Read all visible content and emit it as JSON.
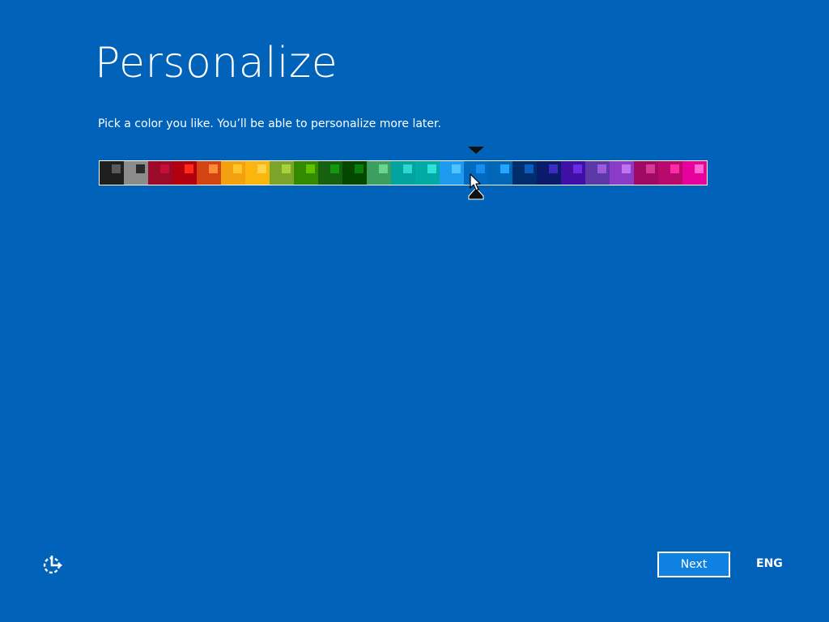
{
  "page": {
    "title": "Personalize",
    "subtitle": "Pick a color you like. You’ll be able to personalize more later."
  },
  "color_picker": {
    "selected_index": 15,
    "swatches": [
      {
        "bg": "#1f1f1f",
        "accent": "#5a5a5a"
      },
      {
        "bg": "#8c8c8c",
        "accent": "#2a2a2a"
      },
      {
        "bg": "#9c0a2a",
        "accent": "#c50f39"
      },
      {
        "bg": "#b3000e",
        "accent": "#ff2a1a"
      },
      {
        "bg": "#d24411",
        "accent": "#ff8a3a"
      },
      {
        "bg": "#f2a20e",
        "accent": "#ffc52e"
      },
      {
        "bg": "#fab60e",
        "accent": "#ffd34a"
      },
      {
        "bg": "#7aa52a",
        "accent": "#a8d23c"
      },
      {
        "bg": "#338a00",
        "accent": "#5fc400"
      },
      {
        "bg": "#15610f",
        "accent": "#0f9a0f"
      },
      {
        "bg": "#044800",
        "accent": "#0b7f0b"
      },
      {
        "bg": "#3c9e5f",
        "accent": "#6bd48e"
      },
      {
        "bg": "#00a39e",
        "accent": "#2fd7d2"
      },
      {
        "bg": "#00aaa5",
        "accent": "#30e0db"
      },
      {
        "bg": "#1e9bf0",
        "accent": "#52c3ff"
      },
      {
        "bg": "#006ac1",
        "accent": "#168ef0"
      },
      {
        "bg": "#0067b8",
        "accent": "#22a8ff"
      },
      {
        "bg": "#002d6b",
        "accent": "#0a5ec0"
      },
      {
        "bg": "#0a1b6b",
        "accent": "#3a2dc0"
      },
      {
        "bg": "#3f0fa8",
        "accent": "#6b2be0"
      },
      {
        "bg": "#5b3aa8",
        "accent": "#9b5ce0"
      },
      {
        "bg": "#8a3cc8",
        "accent": "#c074f0"
      },
      {
        "bg": "#9e0a64",
        "accent": "#d63a92"
      },
      {
        "bg": "#b80a6c",
        "accent": "#ff2aa8"
      },
      {
        "bg": "#e6009c",
        "accent": "#ff66d0"
      }
    ]
  },
  "footer": {
    "next_label": "Next",
    "language": "ENG"
  },
  "icons": {
    "ease_of_access": "ease-of-access-icon",
    "selection_marker_top": "triangle-down-icon",
    "selection_marker_bottom": "triangle-up-icon",
    "cursor": "mouse-pointer-icon"
  },
  "colors": {
    "background": "#0063b9",
    "button_fill": "#0f81e0",
    "text": "#ffffff"
  }
}
